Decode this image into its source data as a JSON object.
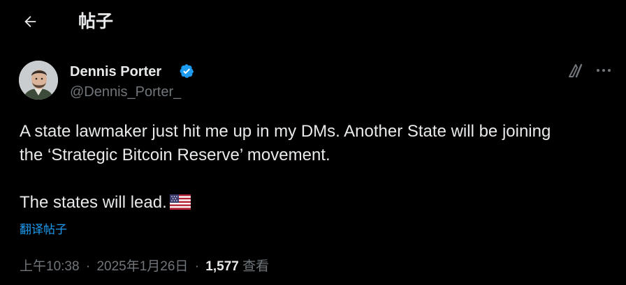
{
  "header": {
    "back_icon": "arrow-left-icon",
    "title": "帖子"
  },
  "author": {
    "display_name": "Dennis Porter",
    "handle": "@Dennis_Porter_",
    "verified_icon": "verified-badge-icon",
    "verified_color": "#1d9bf0"
  },
  "actions": {
    "grok_icon": "grok-icon",
    "more_icon": "more-horizontal-icon"
  },
  "tweet": {
    "line1": "A state lawmaker just hit me up in my DMs. Another State will be joining",
    "line2": "the ‘Strategic Bitcoin Reserve’ movement.",
    "line3": "The states will lead.",
    "flag_icon": "us-flag-emoji",
    "translate_label": "翻译帖子"
  },
  "meta": {
    "time": "上午10:38",
    "date": "2025年1月26日",
    "separator": "·",
    "views_count": "1,577",
    "views_label": "查看"
  },
  "colors": {
    "background": "#000000",
    "text_primary": "#e7e9ea",
    "text_secondary": "#71767b",
    "accent": "#1d9bf0"
  }
}
